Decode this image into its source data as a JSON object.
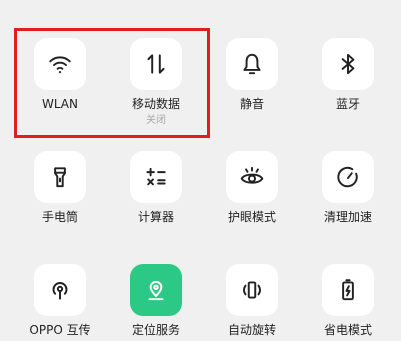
{
  "quick_settings": {
    "row1": [
      {
        "label": "WLAN",
        "icon": "wifi-icon"
      },
      {
        "label": "移动数据",
        "sub": "关闭",
        "icon": "mobile-data-icon"
      },
      {
        "label": "静音",
        "icon": "bell-icon"
      },
      {
        "label": "蓝牙",
        "icon": "bluetooth-icon"
      }
    ],
    "row2": [
      {
        "label": "手电筒",
        "icon": "flashlight-icon"
      },
      {
        "label": "计算器",
        "icon": "calculator-icon"
      },
      {
        "label": "护眼模式",
        "icon": "eye-icon"
      },
      {
        "label": "清理加速",
        "icon": "speedometer-icon"
      }
    ],
    "row3": [
      {
        "label": "OPPO 互传",
        "icon": "oppo-share-icon"
      },
      {
        "label": "定位服务",
        "icon": "location-icon",
        "active": true
      },
      {
        "label": "自动旋转",
        "icon": "rotate-icon"
      },
      {
        "label": "省电模式",
        "icon": "battery-saver-icon"
      }
    ]
  },
  "colors": {
    "background": "#f0f0f0",
    "tile": "#ffffff",
    "active_tile": "#2cc886",
    "highlight_border": "#e01e1e"
  }
}
